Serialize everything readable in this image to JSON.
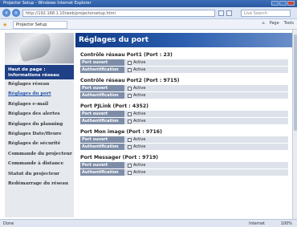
{
  "window": {
    "title": "Projector Setup - Windows Internet Explorer",
    "url": "http://192.168.1.10/web/projectorsetup.html",
    "search_placeholder": "Live Search"
  },
  "browser": {
    "tab_label": "Projector Setup",
    "tools": [
      "Page",
      "Tools"
    ]
  },
  "sidebar": {
    "home_label": "Haut de page : Informations réseau",
    "items": [
      {
        "label": "Réglages réseau",
        "active": false
      },
      {
        "label": "Réglages du port",
        "active": true
      },
      {
        "label": "Réglages e-mail",
        "active": false
      },
      {
        "label": "Réglages des alertes",
        "active": false
      },
      {
        "label": "Réglages du planning",
        "active": false
      },
      {
        "label": "Réglages Date/Heure",
        "active": false
      },
      {
        "label": "Réglages de sécurité",
        "active": false
      },
      {
        "label": "Commande du projecteur",
        "active": false
      },
      {
        "label": "Commande à distance",
        "active": false
      },
      {
        "label": "Statut du projecteur",
        "active": false
      },
      {
        "label": "Redémarrage du réseau",
        "active": false
      }
    ]
  },
  "main": {
    "title": "Réglages du port",
    "row_labels": {
      "open": "Port ouvert",
      "auth": "Authentification"
    },
    "value_label": "Active",
    "sections": [
      {
        "title": "Contrôle réseau Port1 (Port : 23)"
      },
      {
        "title": "Contrôle réseau Port2 (Port : 9715)"
      },
      {
        "title": "Port PJLink (Port : 4352)"
      },
      {
        "title": "Port Mon image (Port : 9716)"
      },
      {
        "title": "Port Messager (Port : 9719)"
      }
    ]
  },
  "status": {
    "left": "Done",
    "zone": "Internet",
    "zoom": "100%"
  }
}
